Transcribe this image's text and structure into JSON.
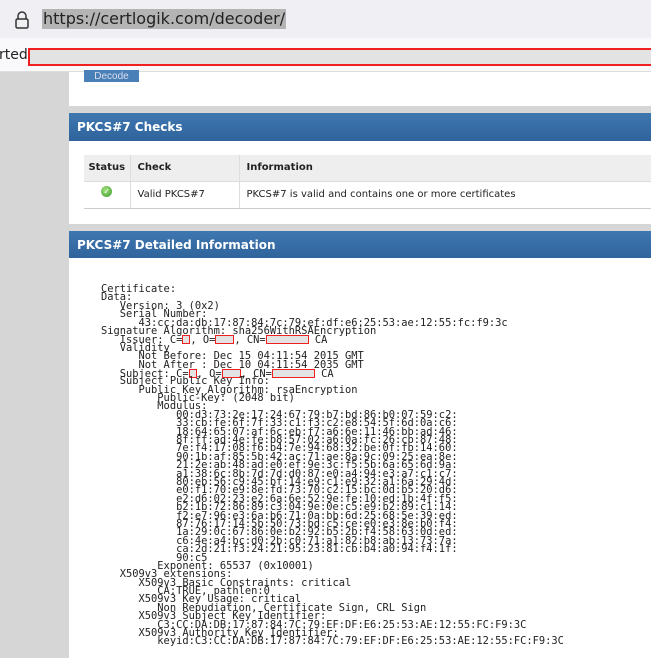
{
  "browser": {
    "url": "https://certlogik.com/decoder/",
    "partial_label": "rted"
  },
  "decode_label": "Decode",
  "checks": {
    "title": "PKCS#7 Checks",
    "headers": [
      "Status",
      "Check",
      "Information"
    ],
    "rows": [
      {
        "status": "ok",
        "check": "Valid PKCS#7",
        "info": "PKCS#7 is valid and contains one or more certificates"
      }
    ],
    "status_color": "#4caf38"
  },
  "details": {
    "title": "PKCS#7 Detailed Information",
    "lines": [
      [
        {
          "t": "Certificate:"
        }
      ],
      [
        {
          "t": "Data:"
        }
      ],
      [
        {
          "t": "   Version: 3 (0x2)"
        }
      ],
      [
        {
          "t": "   Serial Number:"
        }
      ],
      [
        {
          "t": "      43:cc:da:db:17:87:84:7c:79:ef:df:e6:25:53:ae:12:55:fc:f9:3c"
        }
      ],
      [
        {
          "t": "Signature Algorithm: sha256WithRSAEncryption"
        }
      ],
      [
        {
          "t": "   Issuer: C="
        },
        {
          "r": "rs"
        },
        {
          "t": ", O="
        },
        {
          "r": "rm"
        },
        {
          "t": ", CN="
        },
        {
          "r": "rl"
        },
        {
          "t": " CA"
        }
      ],
      [
        {
          "t": "   Validity"
        }
      ],
      [
        {
          "t": "      Not Before: Dec 15 04:11:54 2015 GMT"
        }
      ],
      [
        {
          "t": "      Not After : Dec 10 04:11:54 2035 GMT"
        }
      ],
      [
        {
          "t": "   Subject: C="
        },
        {
          "r": "rs"
        },
        {
          "t": ", O="
        },
        {
          "r": "rm"
        },
        {
          "t": ", CN="
        },
        {
          "r": "rl"
        },
        {
          "t": " CA"
        }
      ],
      [
        {
          "t": "   Subject Public Key Info:"
        }
      ],
      [
        {
          "t": "      Public Key Algorithm: rsaEncryption"
        }
      ],
      [
        {
          "t": "         Public-Key: (2048 bit)"
        }
      ],
      [
        {
          "t": "         Modulus:"
        }
      ],
      [
        {
          "t": "            00:d3:73:2e:17:24:67:79:b7:bd:86:b0:07:59:c2:"
        }
      ],
      [
        {
          "t": "            33:cb:fe:6f:7f:33:c1:f3:c2:e8:54:5f:6d:0a:c6:"
        }
      ],
      [
        {
          "t": "            18:64:65:07:af:6c:eb:f7:a6:6e:11:46:bb:ad:46:"
        }
      ],
      [
        {
          "t": "            8f:ff:ad:4e:fe:b8:57:02:a6:0a:fc:26:cb:87:48:"
        }
      ],
      [
        {
          "t": "            7e:f4:17:08:f6:b4:7e:94:68:32:be:0f:fb:14:60:"
        }
      ],
      [
        {
          "t": "            90:1b:af:85:5b:42:ac:71:ae:8a:9c:09:25:ea:8e:"
        }
      ],
      [
        {
          "t": "            21:2e:ab:48:ad:e0:ef:9e:3c:f5:5b:6a:65:6d:9a:"
        }
      ],
      [
        {
          "t": "            a1:38:6c:8b:7d:7d:d0:87:e0:a4:94:e3:a7:c1:c7:"
        }
      ],
      [
        {
          "t": "            80:eb:56:c9:45:bf:14:e9:c1:e9:32:a1:6a:29:4d:"
        }
      ],
      [
        {
          "t": "            e0:f1:70:e9:8e:fd:73:70:c2:15:bc:0d:b5:20:d6:"
        }
      ],
      [
        {
          "t": "            e2:d6:02:23:e2:6a:6e:52:9e:fe:10:ed:1b:4f:f5:"
        }
      ],
      [
        {
          "t": "            b2:1b:72:86:89:c3:04:9e:0e:c5:e9:b2:89:c1:14:"
        }
      ],
      [
        {
          "t": "            f2:e7:96:e3:6a:b6:71:0a:bb:6d:25:68:5e:39:ed:"
        }
      ],
      [
        {
          "t": "            87:76:17:14:5b:50:73:bd:c5:ce:e0:e3:8e:b0:f4:"
        }
      ],
      [
        {
          "t": "            1a:29:0c:67:86:0e:b2:92:b5:2b:f4:58:63:0d:ed:"
        }
      ],
      [
        {
          "t": "            c6:4e:a4:bc:d0:2b:c0:71:a1:82:b8:ab:13:73:7a:"
        }
      ],
      [
        {
          "t": "            ca:2d:21:f3:24:21:95:23:81:cb:b4:a0:94:f4:1f:"
        }
      ],
      [
        {
          "t": "            90:c5"
        }
      ],
      [
        {
          "t": "         Exponent: 65537 (0x10001)"
        }
      ],
      [
        {
          "t": "   X509v3 extensions:"
        }
      ],
      [
        {
          "t": "      X509v3 Basic Constraints: critical"
        }
      ],
      [
        {
          "t": "         CA:TRUE, pathlen:0"
        }
      ],
      [
        {
          "t": "      X509v3 Key Usage: critical"
        }
      ],
      [
        {
          "t": "         Non Repudiation, Certificate Sign, CRL Sign"
        }
      ],
      [
        {
          "t": "      X509v3 Subject Key Identifier:"
        }
      ],
      [
        {
          "t": "         C3:CC:DA:DB:17:87:84:7C:79:EF:DF:E6:25:53:AE:12:55:FC:F9:3C"
        }
      ],
      [
        {
          "t": "      X509v3 Authority Key Identifier:"
        }
      ],
      [
        {
          "t": "         keyid:C3:CC:DA:DB:17:87:84:7C:79:EF:DF:E6:25:53:AE:12:55:FC:F9:3C"
        }
      ]
    ]
  }
}
